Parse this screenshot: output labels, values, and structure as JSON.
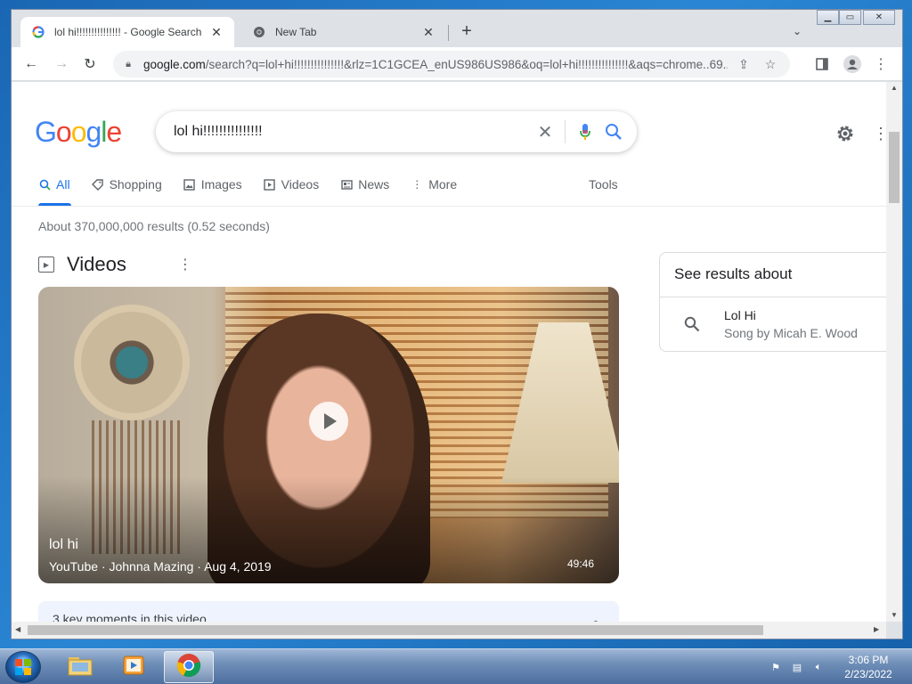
{
  "browser": {
    "tabs": [
      {
        "label": "lol hi!!!!!!!!!!!!!!! - Google Search",
        "active": true,
        "favicon": "google-icon"
      },
      {
        "label": "New Tab",
        "active": false,
        "favicon": "chrome-icon"
      }
    ],
    "url_host": "google.com",
    "url_path": "/search?q=lol+hi!!!!!!!!!!!!!!!&rlz=1C1GCEA_enUS986US986&oq=lol+hi!!!!!!!!!!!!!!!&aqs=chrome..69..."
  },
  "google": {
    "logo_letters": [
      {
        "ch": "G",
        "color": "#4285f4"
      },
      {
        "ch": "o",
        "color": "#ea4335"
      },
      {
        "ch": "o",
        "color": "#fbbc05"
      },
      {
        "ch": "g",
        "color": "#4285f4"
      },
      {
        "ch": "l",
        "color": "#34a853"
      },
      {
        "ch": "e",
        "color": "#ea4335"
      }
    ],
    "query": "lol hi!!!!!!!!!!!!!!!",
    "nav_tabs": [
      {
        "label": "All",
        "icon": "search-icon",
        "active": true
      },
      {
        "label": "Shopping",
        "icon": "tag-icon"
      },
      {
        "label": "Images",
        "icon": "image-icon"
      },
      {
        "label": "Videos",
        "icon": "play-icon"
      },
      {
        "label": "News",
        "icon": "newspaper-icon"
      },
      {
        "label": "More",
        "icon": "dots-vertical-icon"
      }
    ],
    "tools_label": "Tools",
    "result_stats": "About 370,000,000 results (0.52 seconds)",
    "videos_heading": "Videos",
    "video": {
      "title": "lol hi",
      "meta": "YouTube · Johnna Mazing · Aug 4, 2019",
      "duration": "49:46"
    },
    "key_moments": "3 key moments in this video",
    "knowledge_panel": {
      "heading": "See results about",
      "item_title": "Lol Hi",
      "item_subtitle": "Song by Micah E. Wood"
    }
  },
  "taskbar": {
    "time": "3:06 PM",
    "date": "2/23/2022"
  },
  "colors": {
    "accent": "#1a73e8",
    "chrome_tab_bg": "#dee1e6"
  }
}
